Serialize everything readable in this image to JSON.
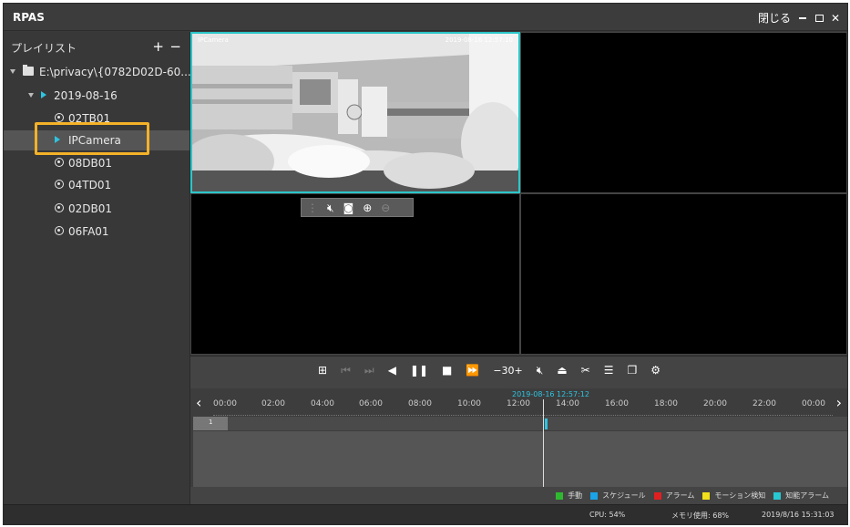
{
  "app": {
    "title": "RPAS"
  },
  "window_controls": {
    "close_label": "閉じる"
  },
  "sidebar": {
    "title": "プレイリスト",
    "add": "+",
    "remove": "−",
    "path": "E:\\privacy\\{0782D02D-60...",
    "date": "2019-08-16",
    "items": [
      {
        "label": "02TB01"
      },
      {
        "label": "IPCamera"
      },
      {
        "label": "08DB01"
      },
      {
        "label": "04TD01"
      },
      {
        "label": "02DB01"
      },
      {
        "label": "06FA01"
      }
    ]
  },
  "video": {
    "camera_label": "IPCamera",
    "timestamp": "2019-08-16 12:57:10"
  },
  "controls": {
    "speed": "30"
  },
  "timeline": {
    "cursor_time": "2019-08-16 12:57:12",
    "hours": [
      "00:00",
      "02:00",
      "04:00",
      "06:00",
      "08:00",
      "10:00",
      "12:00",
      "14:00",
      "16:00",
      "18:00",
      "20:00",
      "22:00",
      "00:00"
    ],
    "track_label": "1"
  },
  "legend": [
    {
      "label": "手動",
      "color": "#2fb82f"
    },
    {
      "label": "スケジュール",
      "color": "#1aa3e8"
    },
    {
      "label": "アラーム",
      "color": "#e02020"
    },
    {
      "label": "モーション検知",
      "color": "#f2e01a"
    },
    {
      "label": "知能アラーム",
      "color": "#27c8d0"
    }
  ],
  "status": {
    "cpu": "CPU: 54%",
    "memory": "メモリ使用: 68%",
    "datetime": "2019/8/16 15:31:03"
  }
}
